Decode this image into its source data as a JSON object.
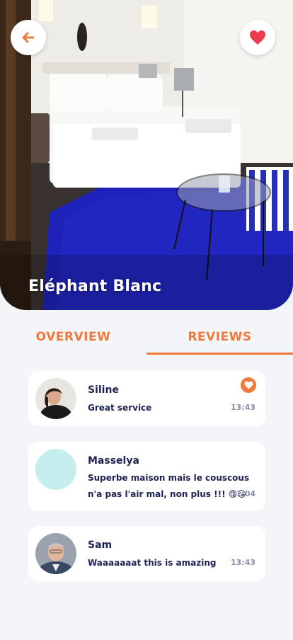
{
  "property": {
    "name": "Eléphant Blanc"
  },
  "icons": {
    "back": "arrow-left-icon",
    "favorite": "heart-icon",
    "like": "heart-icon"
  },
  "colors": {
    "accent": "#f07a3c",
    "text_dark": "#1e2353",
    "muted": "#8a8fa6",
    "background": "#f4f5f9"
  },
  "tabs": [
    {
      "label": "OVERVIEW",
      "active": false
    },
    {
      "label": "REVIEWS",
      "active": true
    }
  ],
  "reviews": [
    {
      "name": "Siline",
      "message": "Great service",
      "time": "13:43",
      "liked": true
    },
    {
      "name": "Masselya",
      "message_line1": "Superbe maison mais le couscous",
      "message_line2": "n'a pas l'air mal, non plus !!! 😋😘",
      "time": "11:04",
      "liked": false
    },
    {
      "name": "Sam",
      "message": "Waaaaaaat this is amazing",
      "time": "13:43",
      "liked": false
    }
  ]
}
